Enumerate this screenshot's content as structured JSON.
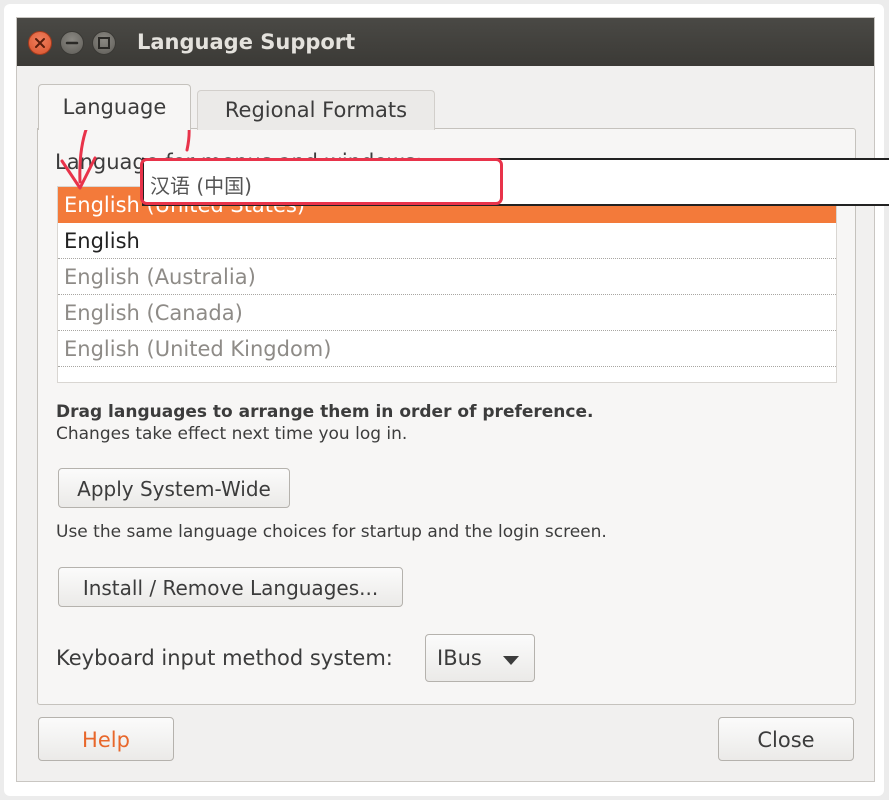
{
  "window": {
    "title": "Language Support"
  },
  "tabs": [
    {
      "label": "Language",
      "selected": true
    },
    {
      "label": "Regional Formats",
      "selected": false
    }
  ],
  "language_list": {
    "heading": "Language for menus and windows:",
    "items": [
      {
        "label": "English (United States)",
        "state": "selected"
      },
      {
        "label": "English",
        "state": "active"
      },
      {
        "label": "English (Australia)",
        "state": "inactive"
      },
      {
        "label": "English (Canada)",
        "state": "inactive"
      },
      {
        "label": "English (United Kingdom)",
        "state": "inactive"
      }
    ],
    "drag_item": "汉语 (中国)"
  },
  "notes": {
    "drag_hint": "Drag languages to arrange them in order of preference.",
    "effect_hint": "Changes take effect next time you log in."
  },
  "buttons": {
    "apply_system_wide": "Apply System-Wide",
    "apply_description": "Use the same language choices for startup and the login screen.",
    "install_remove": "Install / Remove Languages...",
    "help": "Help",
    "close": "Close"
  },
  "keyboard": {
    "label": "Keyboard input method system:",
    "value": "IBus"
  },
  "colors": {
    "selection": "#f37a3a",
    "annotation": "#e8334a",
    "titlebar": "#3b3a36"
  }
}
